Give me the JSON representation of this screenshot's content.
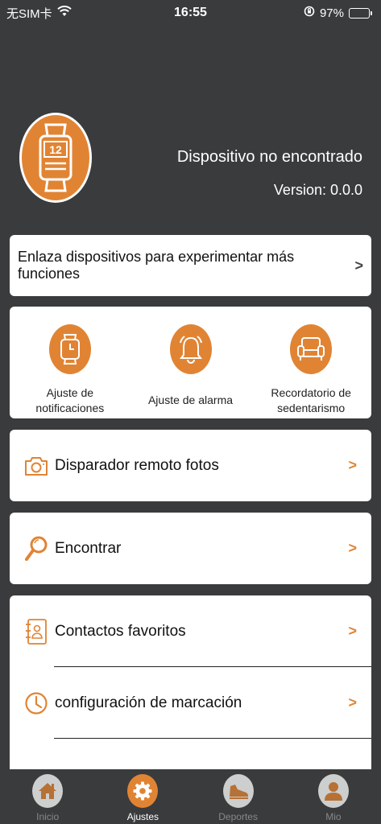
{
  "status": {
    "carrier": "无SIM卡",
    "time": "16:55",
    "battery": "97%",
    "battery_level": 0.97
  },
  "device": {
    "name": "Dispositivo no encontrado",
    "version": "Version: 0.0.0",
    "icon_number": "12"
  },
  "link_card": {
    "label": "Enlaza dispositivos para experimentar más funciones",
    "chevron": ">"
  },
  "functions": [
    {
      "label": "Ajuste de notificaciones",
      "icon": "watch-icon"
    },
    {
      "label": "Ajuste de alarma",
      "icon": "alarm-bell-icon"
    },
    {
      "label": "Recordatorio de sedentarismo",
      "icon": "armchair-icon"
    }
  ],
  "rows": {
    "remote": {
      "label": "Disparador remoto fotos",
      "icon": "camera-icon"
    },
    "find": {
      "label": "Encontrar",
      "icon": "magnifier-icon"
    },
    "contacts": {
      "label": "Contactos favoritos",
      "icon": "contacts-book-icon"
    },
    "dial": {
      "label": "configuración de marcación",
      "icon": "clock-icon"
    }
  },
  "chevron": ">",
  "tabs": [
    {
      "label": "Inicio",
      "icon": "home-icon",
      "active": false
    },
    {
      "label": "Ajustes",
      "icon": "gear-icon",
      "active": true
    },
    {
      "label": "Deportes",
      "icon": "running-shoe-icon",
      "active": false
    },
    {
      "label": "Mio",
      "icon": "user-icon",
      "active": false
    }
  ],
  "colors": {
    "accent": "#e08434",
    "background": "#3a3b3d",
    "card": "#ffffff"
  }
}
